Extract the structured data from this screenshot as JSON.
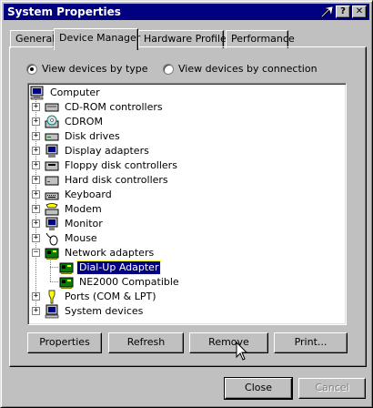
{
  "window": {
    "title": "System Properties"
  },
  "titlebar": {
    "help_label": "?",
    "close_label": "✕"
  },
  "tabs": [
    {
      "label": "General"
    },
    {
      "label": "Device Manager"
    },
    {
      "label": "Hardware Profiles"
    },
    {
      "label": "Performance"
    }
  ],
  "view": {
    "by_type": "View devices by type",
    "by_connection": "View devices by connection",
    "selected": "by_type"
  },
  "tree": {
    "root": {
      "label": "Computer",
      "icon": "computer-icon"
    },
    "categories": [
      {
        "label": "CD-ROM controllers",
        "icon": "cdrom-controller-icon",
        "expander": "+"
      },
      {
        "label": "CDROM",
        "icon": "cdrom-icon",
        "expander": "+"
      },
      {
        "label": "Disk drives",
        "icon": "disk-drive-icon",
        "expander": "+"
      },
      {
        "label": "Display adapters",
        "icon": "display-adapter-icon",
        "expander": "+"
      },
      {
        "label": "Floppy disk controllers",
        "icon": "floppy-controller-icon",
        "expander": "+"
      },
      {
        "label": "Hard disk controllers",
        "icon": "hard-disk-controller-icon",
        "expander": "+"
      },
      {
        "label": "Keyboard",
        "icon": "keyboard-icon",
        "expander": "+"
      },
      {
        "label": "Modem",
        "icon": "modem-icon",
        "expander": "+"
      },
      {
        "label": "Monitor",
        "icon": "monitor-icon",
        "expander": "+"
      },
      {
        "label": "Mouse",
        "icon": "mouse-icon",
        "expander": "+"
      },
      {
        "label": "Network adapters",
        "icon": "network-adapter-icon",
        "expander": "−"
      },
      {
        "label": "Ports (COM & LPT)",
        "icon": "ports-icon",
        "expander": "+"
      },
      {
        "label": "System devices",
        "icon": "system-devices-icon",
        "expander": "+"
      }
    ],
    "network_children": [
      {
        "label": "Dial-Up Adapter",
        "icon": "network-adapter-icon",
        "selected": true
      },
      {
        "label": "NE2000 Compatible",
        "icon": "network-adapter-icon",
        "selected": false
      }
    ]
  },
  "actions": {
    "properties": "Properties",
    "refresh": "Refresh",
    "remove": "Remove",
    "print": "Print..."
  },
  "footer": {
    "close": "Close",
    "cancel": "Cancel"
  },
  "colors": {
    "title_bar": "#000080",
    "face": "#c0c0c0",
    "selection": "#000080"
  }
}
